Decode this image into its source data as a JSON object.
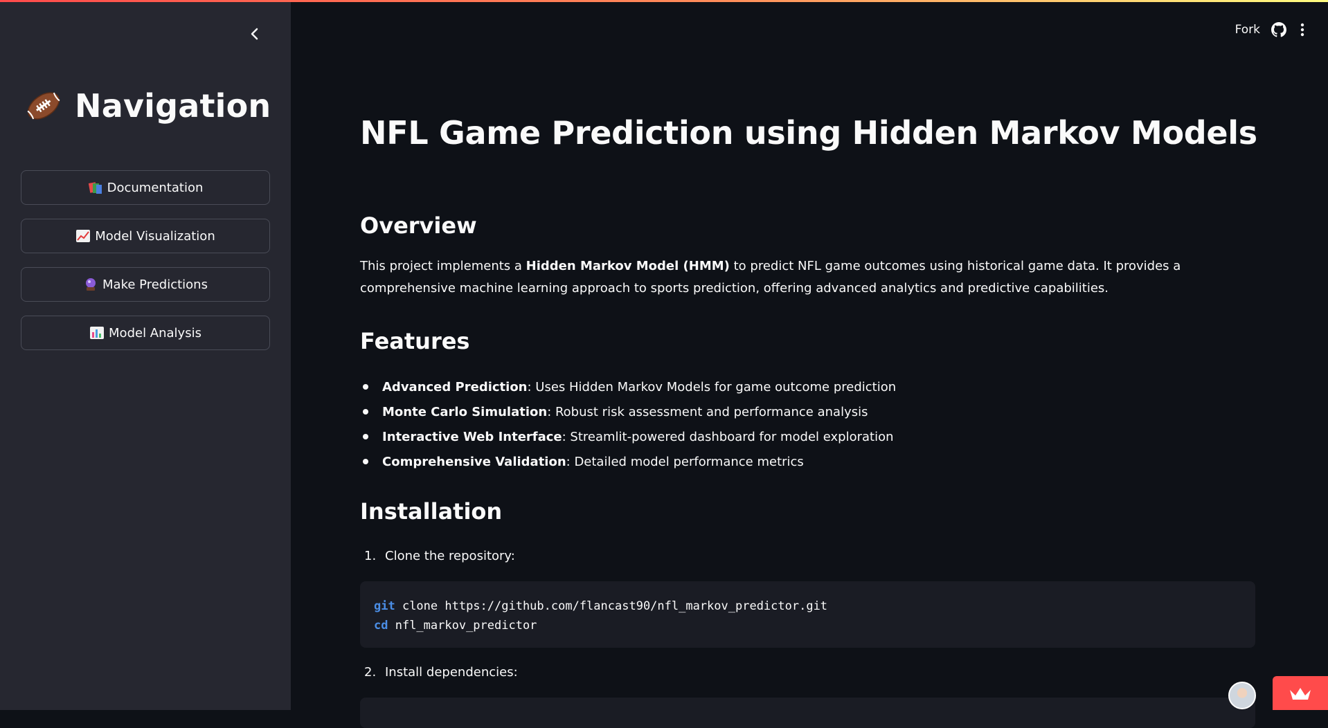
{
  "sidebar": {
    "title": "Navigation",
    "title_icon": "american-football-icon",
    "buttons": [
      {
        "label": "Documentation",
        "icon": "books-icon"
      },
      {
        "label": "Model Visualization",
        "icon": "chart-increasing-icon"
      },
      {
        "label": "Make Predictions",
        "icon": "crystal-ball-icon"
      },
      {
        "label": "Model Analysis",
        "icon": "bar-chart-icon"
      }
    ]
  },
  "header": {
    "fork_label": "Fork"
  },
  "main": {
    "title": "NFL Game Prediction using Hidden Markov Models",
    "overview": {
      "heading": "Overview",
      "text_before": "This project implements a ",
      "bold": "Hidden Markov Model (HMM)",
      "text_after": " to predict NFL game outcomes using historical game data. It provides a comprehensive machine learning approach to sports prediction, offering advanced analytics and predictive capabilities."
    },
    "features": {
      "heading": "Features",
      "items": [
        {
          "bold": "Advanced Prediction",
          "text": ": Uses Hidden Markov Models for game outcome prediction"
        },
        {
          "bold": "Monte Carlo Simulation",
          "text": ": Robust risk assessment and performance analysis"
        },
        {
          "bold": "Interactive Web Interface",
          "text": ": Streamlit-powered dashboard for model exploration"
        },
        {
          "bold": "Comprehensive Validation",
          "text": ": Detailed model performance metrics"
        }
      ]
    },
    "installation": {
      "heading": "Installation",
      "steps": [
        {
          "num": "1.",
          "text": "Clone the repository:"
        },
        {
          "num": "2.",
          "text": "Install dependencies:"
        }
      ],
      "code_lines": [
        {
          "kw": "git",
          "rest": " clone https://github.com/flancast90/nfl_markov_predictor.git"
        },
        {
          "kw": "cd",
          "rest": " nfl_markov_predictor"
        }
      ]
    }
  }
}
